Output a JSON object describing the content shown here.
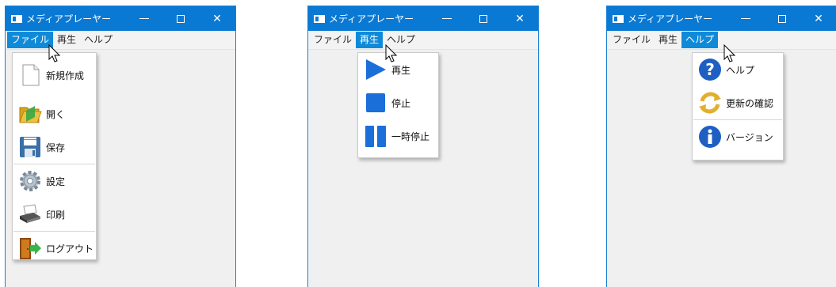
{
  "window": {
    "title": "メディアプレーヤー",
    "minimize_icon": "minimize-icon",
    "maximize_icon": "maximize-icon",
    "close_glyph": "✕"
  },
  "menubar": {
    "file": "ファイル",
    "play": "再生",
    "help": "ヘルプ"
  },
  "file_menu": {
    "items": [
      {
        "label": "新規作成",
        "icon": "new-document-icon"
      },
      {
        "label": "開く",
        "icon": "open-folder-icon"
      },
      {
        "label": "保存",
        "icon": "save-icon"
      },
      {
        "label": "設定",
        "icon": "settings-gear-icon"
      },
      {
        "label": "印刷",
        "icon": "printer-icon"
      },
      {
        "label": "ログアウト",
        "icon": "logout-door-icon"
      }
    ]
  },
  "play_menu": {
    "items": [
      {
        "label": "再生",
        "icon": "play-icon"
      },
      {
        "label": "停止",
        "icon": "stop-icon"
      },
      {
        "label": "一時停止",
        "icon": "pause-icon"
      }
    ]
  },
  "help_menu": {
    "items": [
      {
        "label": "ヘルプ",
        "icon": "question-icon"
      },
      {
        "label": "更新の確認",
        "icon": "refresh-icon"
      },
      {
        "label": "バージョン",
        "icon": "info-icon"
      }
    ]
  },
  "colors": {
    "titlebar": "#0a79d4",
    "menu_highlight": "#0f8ad8",
    "window_bg": "#f0f0f0"
  }
}
